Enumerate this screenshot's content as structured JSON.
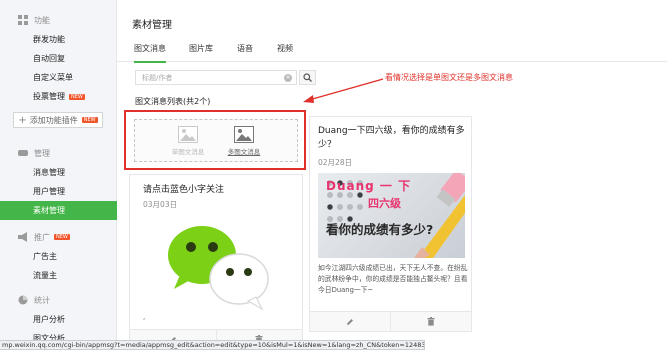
{
  "sidebar": {
    "function_section": {
      "title": "功能",
      "items": [
        "群发功能",
        "自动回复",
        "自定义菜单",
        "投票管理"
      ],
      "vote_badge": "NEW"
    },
    "add_plugin": {
      "label": "添加功能插件",
      "badge": "NEW"
    },
    "manage_section": {
      "title": "管理",
      "items": [
        "消息管理",
        "用户管理",
        "素材管理"
      ]
    },
    "promo_section": {
      "title": "推广",
      "badge": "NEW",
      "items": [
        "广告主",
        "流量主"
      ]
    },
    "stats_section": {
      "title": "统计",
      "items": [
        "用户分析",
        "图文分析"
      ]
    }
  },
  "main": {
    "page_title": "素材管理",
    "tabs": [
      "图文消息",
      "图片库",
      "语音",
      "视频"
    ],
    "active_tab": "图文消息",
    "search_placeholder": "标题/作者",
    "list_title": "图文消息列表(共2个)",
    "new_single": "单图文消息",
    "new_multi": "多图文消息",
    "annotation": "看情况选择是单图文还是多图文消息"
  },
  "cards": [
    {
      "title": "请点击蓝色小字关注",
      "date": "03月03日",
      "summary": ","
    },
    {
      "title": "Duang一下四六级，看你的成绩有多少？",
      "date": "02月28日",
      "image_text_1": "Duang 一 下",
      "image_text_2": "四六级",
      "image_text_3": "看你的成绩有多少?",
      "summary": "如今江湖四六级成绩已出，天下无人不查。在纷乱的武林纷争中，你的成绩是否能独占鳌头呢？且看今日Duang一下~"
    }
  ],
  "status_url": "mp.weixin.qq.com/cgi-bin/appmsg?t=media/appmsg_edit&action=edit&type=10&isMul=1&isNew=1&lang=zh_CN&token=1248382365",
  "colors": {
    "accent": "#44b549",
    "annotation": "#e0302a",
    "badge": "#f0552c"
  }
}
